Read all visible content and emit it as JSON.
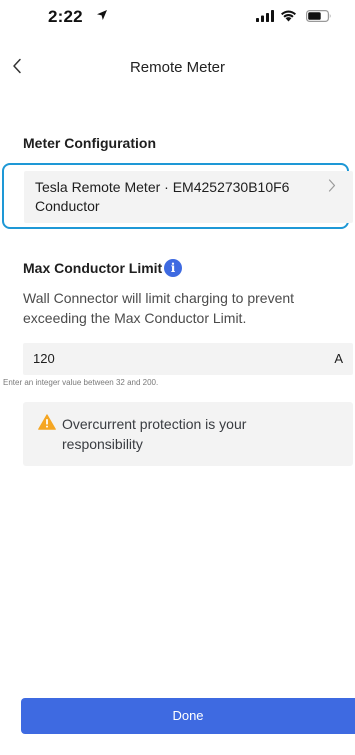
{
  "status_bar": {
    "time": "2:22"
  },
  "nav": {
    "title": "Remote Meter"
  },
  "meter_config": {
    "heading": "Meter Configuration",
    "selected": "Tesla Remote Meter · EM4252730B10F6 Conductor"
  },
  "max_limit": {
    "heading": "Max Conductor Limit",
    "info_icon_glyph": "i",
    "description": "Wall Connector will limit charging to prevent exceeding the Max Conductor Limit.",
    "value": "120",
    "unit": "A",
    "hint": "Enter an integer value between 32 and 200."
  },
  "warning": {
    "text": "Overcurrent protection is your responsibility"
  },
  "done_label": "Done",
  "colors": {
    "accent": "#3e6ae1",
    "highlight_border": "#1e98d6",
    "warning_icon": "#f5a623",
    "field_bg": "#f3f3f3"
  }
}
